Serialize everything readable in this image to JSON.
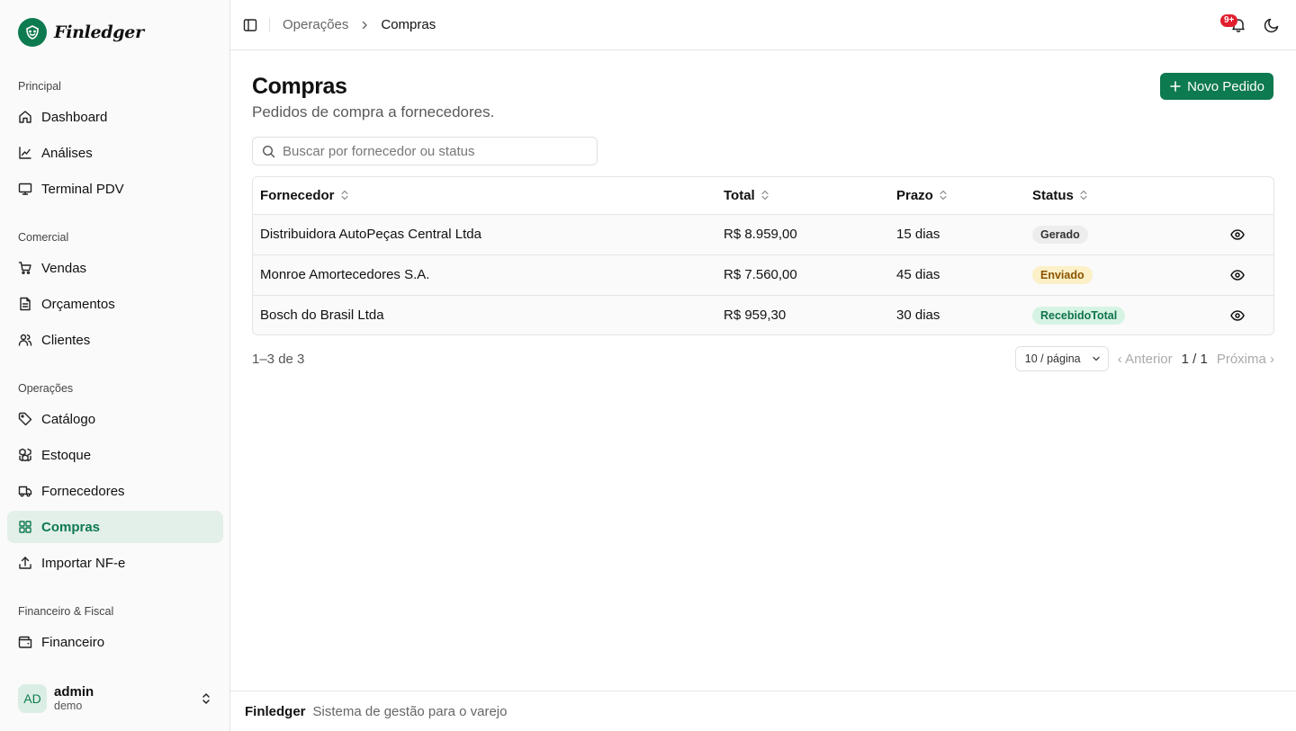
{
  "app": {
    "name": "Finledger",
    "brand_color": "#0e7a4f"
  },
  "sidebar": {
    "groups": [
      {
        "label": "Principal",
        "items": [
          {
            "label": "Dashboard",
            "icon": "home-icon"
          },
          {
            "label": "Análises",
            "icon": "line-chart-icon"
          },
          {
            "label": "Terminal PDV",
            "icon": "monitor-icon"
          }
        ]
      },
      {
        "label": "Comercial",
        "items": [
          {
            "label": "Vendas",
            "icon": "shopping-cart-icon"
          },
          {
            "label": "Orçamentos",
            "icon": "file-text-icon"
          },
          {
            "label": "Clientes",
            "icon": "users-icon"
          }
        ]
      },
      {
        "label": "Operações",
        "items": [
          {
            "label": "Catálogo",
            "icon": "tag-icon"
          },
          {
            "label": "Estoque",
            "icon": "boxes-icon"
          },
          {
            "label": "Fornecedores",
            "icon": "truck-icon"
          },
          {
            "label": "Compras",
            "icon": "grid-icon",
            "active": true
          },
          {
            "label": "Importar NF-e",
            "icon": "upload-icon"
          }
        ]
      },
      {
        "label": "Financeiro & Fiscal",
        "items": [
          {
            "label": "Financeiro",
            "icon": "wallet-icon"
          }
        ]
      }
    ],
    "user": {
      "initials": "AD",
      "name": "admin",
      "org": "demo"
    }
  },
  "header": {
    "breadcrumb": [
      "Operações",
      "Compras"
    ],
    "notifications_badge": "9+"
  },
  "main": {
    "title": "Compras",
    "subtitle": "Pedidos de compra a fornecedores.",
    "new_button_label": "Novo Pedido",
    "search_placeholder": "Buscar por fornecedor ou status",
    "table": {
      "columns": [
        "Fornecedor",
        "Total",
        "Prazo",
        "Status"
      ],
      "rows": [
        {
          "fornecedor": "Distribuidora AutoPeças Central Ltda",
          "total": "R$ 8.959,00",
          "prazo": "15 dias",
          "status": "Gerado",
          "status_color": "#ededed"
        },
        {
          "fornecedor": "Monroe Amortecedores S.A.",
          "total": "R$ 7.560,00",
          "prazo": "45 dias",
          "status": "Enviado",
          "status_color": "#fbf0c7"
        },
        {
          "fornecedor": "Bosch do Brasil Ltda",
          "total": "R$ 959,30",
          "prazo": "30 dias",
          "status": "RecebidoTotal",
          "status_color": "#d6f3e3"
        }
      ]
    },
    "pagination": {
      "count": "1–3 de 3",
      "page_size": "10 / página",
      "prev": "‹ Anterior",
      "current": "1 / 1",
      "next": "Próxima ›"
    }
  },
  "footer": {
    "brand": "Finledger",
    "tagline": "Sistema de gestão para o varejo"
  }
}
